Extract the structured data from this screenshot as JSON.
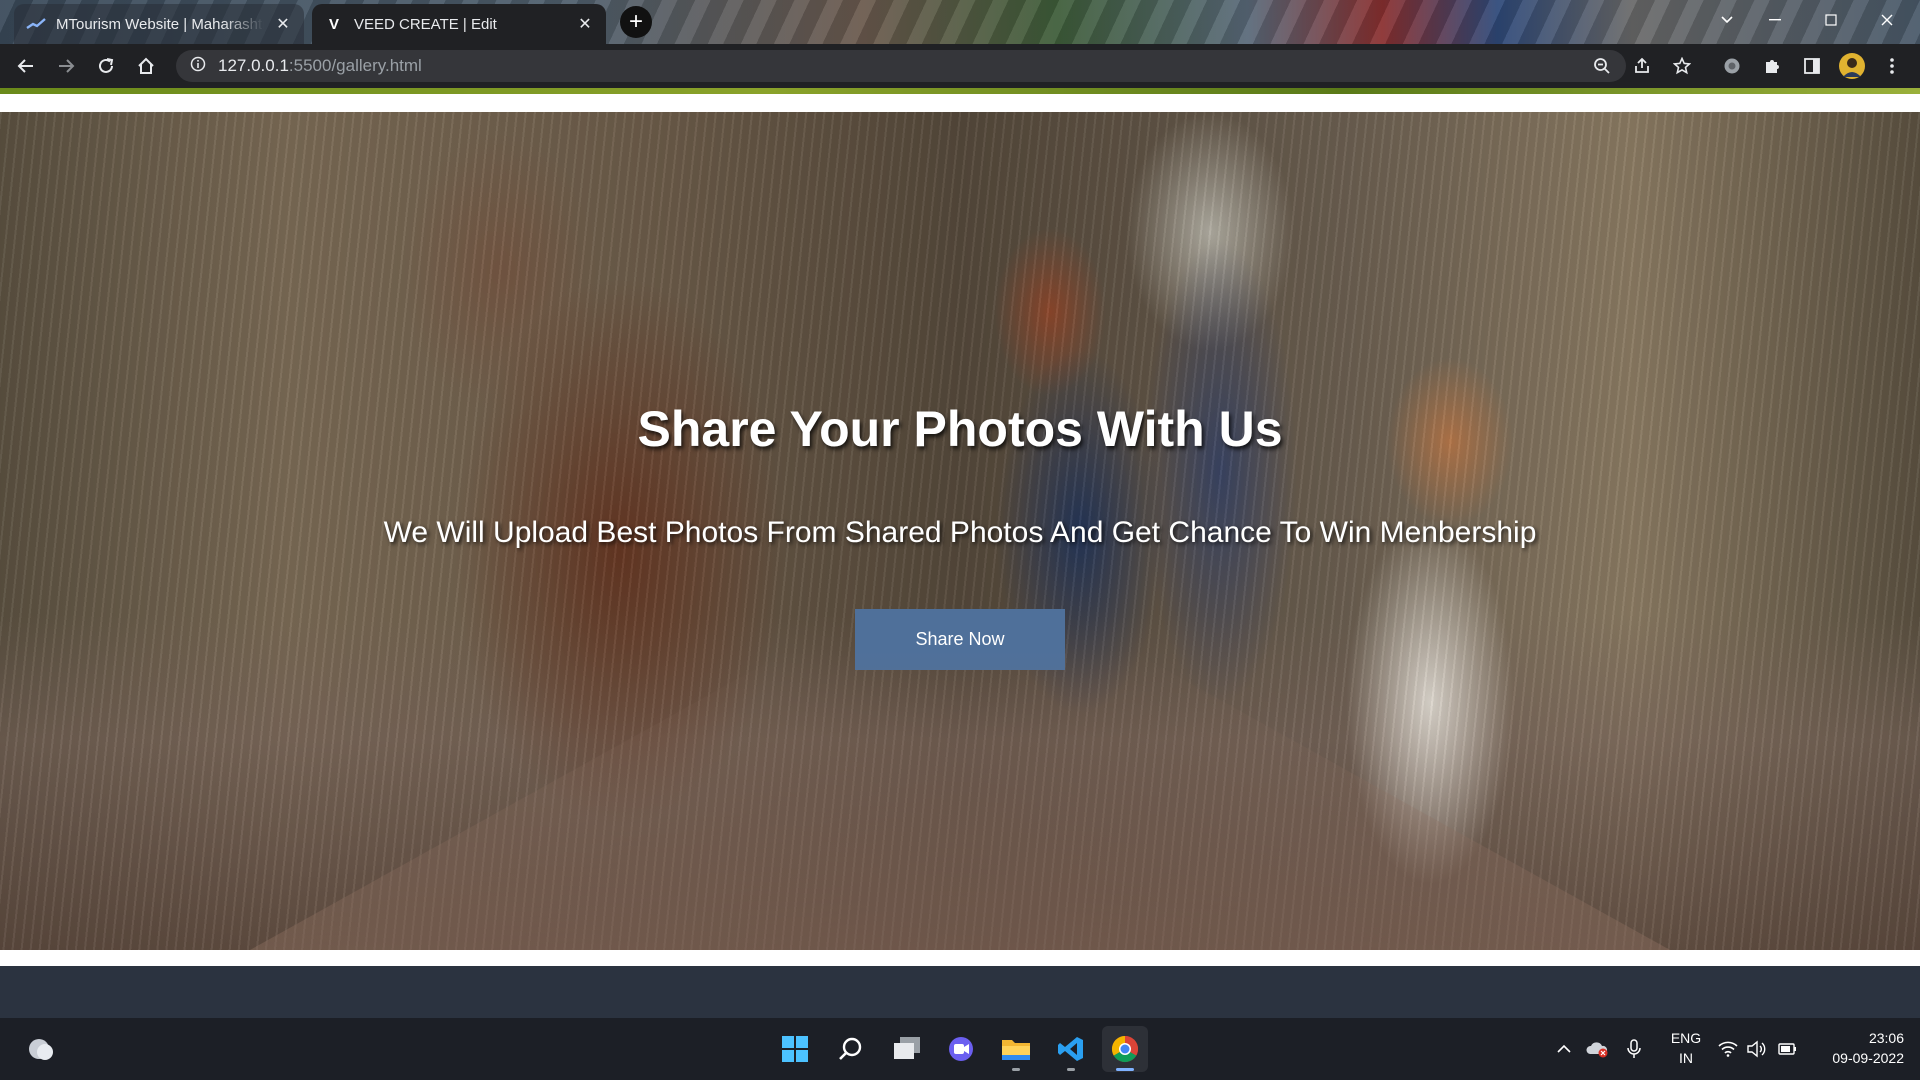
{
  "browser": {
    "tabs": [
      {
        "title": "MTourism Website | Maharashtra",
        "favicon": "mtourism-logo-icon",
        "close": "✕"
      },
      {
        "title": "VEED CREATE | Edit",
        "favicon_text": "V",
        "close": "✕"
      }
    ],
    "new_tab": "+",
    "url_host": "127.0.0.1",
    "url_path": ":5500/gallery.html",
    "colors": {
      "tabstrip": "#3a4a5a",
      "toolbar": "#202124",
      "omnibox": "#35363a"
    }
  },
  "hero": {
    "title": "Share Your Photos With Us",
    "subtitle": "We Will Upload Best Photos From Shared Photos And Get Chance To Win Menbership",
    "button_label": "Share Now",
    "button_color": "#4f709a"
  },
  "taskbar": {
    "apps": [
      "windows-start-icon",
      "search-icon",
      "task-view-icon",
      "chat-icon",
      "file-explorer-icon",
      "vscode-icon",
      "chrome-icon"
    ],
    "language_line1": "ENG",
    "language_line2": "IN",
    "time": "23:06",
    "date": "09-09-2022"
  }
}
